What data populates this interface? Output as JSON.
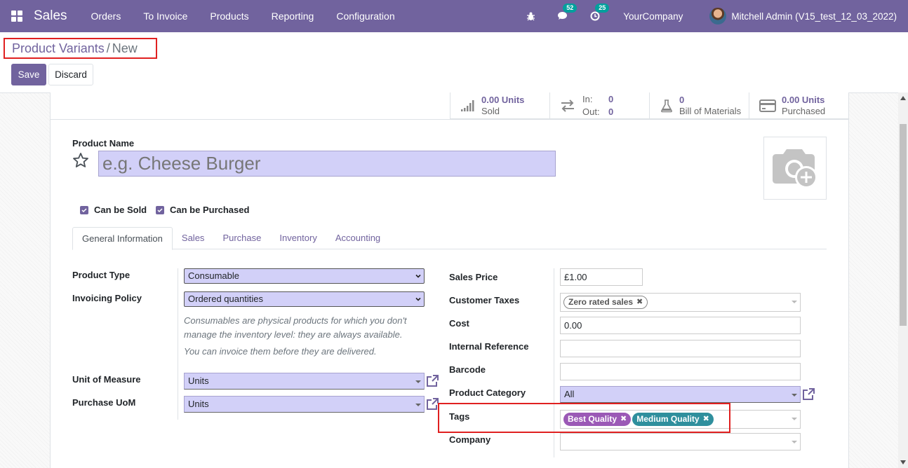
{
  "navbar": {
    "app_name": "Sales",
    "menu": [
      "Orders",
      "To Invoice",
      "Products",
      "Reporting",
      "Configuration"
    ],
    "messages_count": "52",
    "activities_count": "25",
    "company": "YourCompany",
    "user": "Mitchell Admin (V15_test_12_03_2022)"
  },
  "breadcrumb": {
    "parent": "Product Variants",
    "separator": "/",
    "current": "New"
  },
  "buttons": {
    "save": "Save",
    "discard": "Discard"
  },
  "smart_buttons": {
    "sold": {
      "value": "0.00 Units",
      "label": "Sold"
    },
    "moves": {
      "in_label": "In:",
      "in_value": "0",
      "out_label": "Out:",
      "out_value": "0"
    },
    "bom": {
      "value": "0",
      "label": "Bill of Materials"
    },
    "purchased": {
      "value": "0.00 Units",
      "label": "Purchased"
    }
  },
  "product": {
    "name_label": "Product Name",
    "name_placeholder": "e.g. Cheese Burger",
    "can_be_sold": "Can be Sold",
    "can_be_purchased": "Can be Purchased"
  },
  "tabs": [
    "General Information",
    "Sales",
    "Purchase",
    "Inventory",
    "Accounting"
  ],
  "left_fields": {
    "product_type_label": "Product Type",
    "product_type_value": "Consumable",
    "invoicing_policy_label": "Invoicing Policy",
    "invoicing_policy_value": "Ordered quantities",
    "help_1": "Consumables are physical products for which you don't manage the inventory level: they are always available.",
    "help_2": "You can invoice them before they are delivered.",
    "uom_label": "Unit of Measure",
    "uom_value": "Units",
    "purchase_uom_label": "Purchase UoM",
    "purchase_uom_value": "Units"
  },
  "right_fields": {
    "sales_price_label": "Sales Price",
    "sales_price_value": "£1.00",
    "customer_taxes_label": "Customer Taxes",
    "customer_tax_tag": "Zero rated sales",
    "cost_label": "Cost",
    "cost_value": "0.00",
    "internal_ref_label": "Internal Reference",
    "barcode_label": "Barcode",
    "category_label": "Product Category",
    "category_value": "All",
    "tags_label": "Tags",
    "tags": [
      "Best Quality",
      "Medium Quality"
    ],
    "company_label": "Company"
  },
  "colors": {
    "primary": "#71639e",
    "required_bg": "#d2d0f8",
    "highlight": "#e02020",
    "tag_purple": "#9b59b6",
    "tag_teal": "#2f8f9d"
  }
}
